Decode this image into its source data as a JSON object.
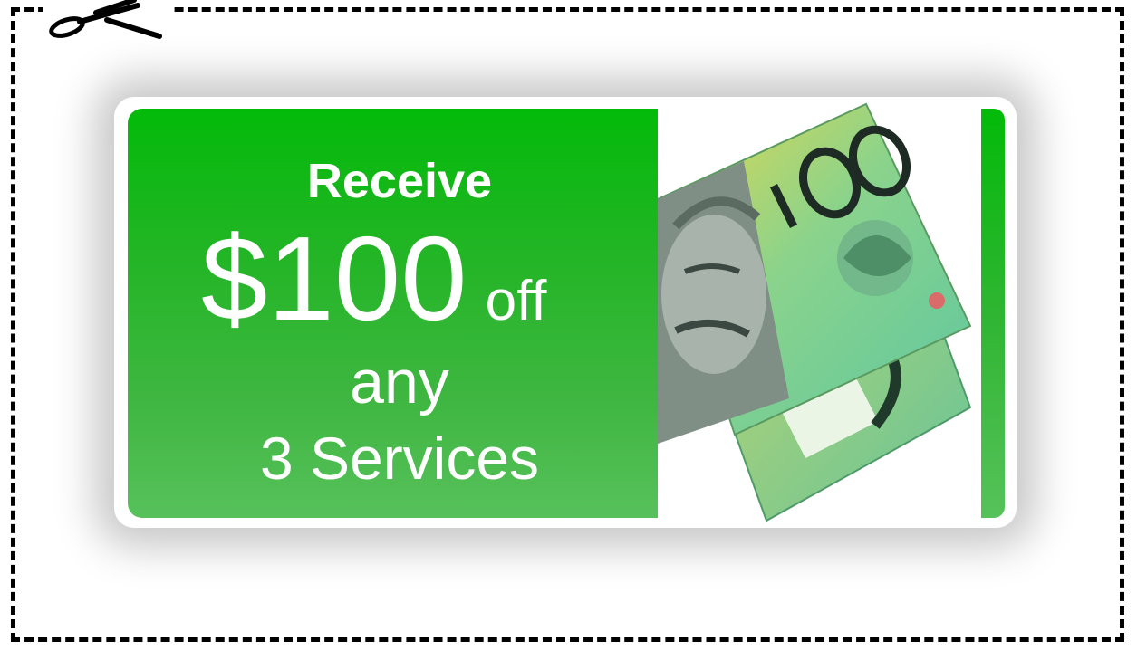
{
  "coupon": {
    "headline": "Receive",
    "amount": "$100",
    "amount_suffix": "off",
    "line3": "any",
    "line4": "3 Services"
  },
  "banknote": {
    "denomination": "100",
    "currency_image": "australian-100-dollar-notes"
  },
  "colors": {
    "green": "#03ba09",
    "green_light": "#57c15b",
    "border": "#000000",
    "note_green": "#7cd39a",
    "note_yellow": "#e7d84c"
  }
}
